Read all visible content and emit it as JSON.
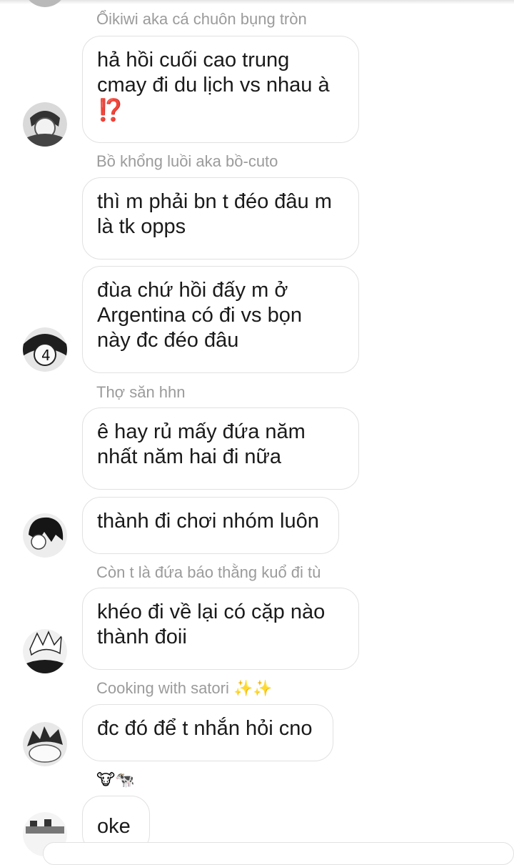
{
  "messages": [
    {
      "sender": "Ổikiwi aka cá chuôn bụng tròn",
      "lines": [
        "hả hồi cuối cao trung",
        "cmay đi du lịch vs nhau à"
      ],
      "emoji": "⁉️"
    },
    {
      "sender": "Bồ khổng luồi aka bồ-cuto",
      "lines": [
        "thì m phải bn t đéo đâu m",
        "là tk opps"
      ]
    },
    {
      "lines": [
        "đùa chứ hồi đấy m ở",
        "Argentina có đi vs bọn",
        "này đc đéo đâu"
      ]
    },
    {
      "sender": "Thợ săn hhn",
      "lines": [
        "ê hay rủ mấy đứa năm",
        "nhất năm hai đi nữa"
      ]
    },
    {
      "lines": [
        "thành đi chơi nhóm luôn"
      ]
    },
    {
      "sender": "Còn t là đứa báo thằng kuổ đi tù",
      "lines": [
        "khéo đi về lại có cặp nào",
        "thành đoii"
      ]
    },
    {
      "sender": "Cooking with satori",
      "sender_emoji": "✨✨",
      "lines": [
        "đc đó để t nhắn hỏi cno"
      ]
    },
    {
      "reactions": "🐮🐄",
      "lines": [
        "oke"
      ]
    }
  ],
  "icons": {
    "avatar": "avatar-icon",
    "interrobang": "interrobang-emoji",
    "sparkles": "sparkles-emoji",
    "cow": "cow-emoji"
  }
}
